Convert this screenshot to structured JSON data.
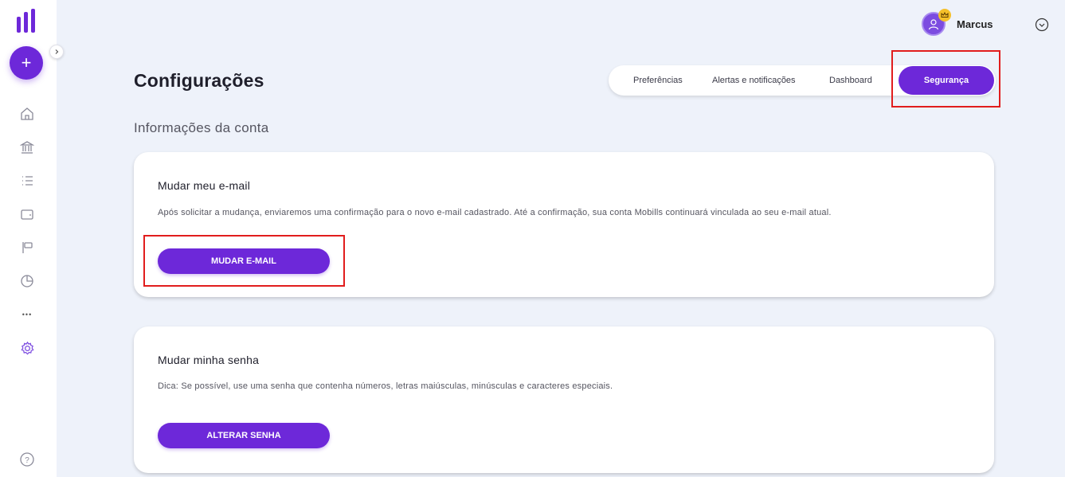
{
  "sidebar": {
    "add_label": "+",
    "icons": [
      "home-icon",
      "bank-icon",
      "list-icon",
      "wallet-icon",
      "flag-icon",
      "pie-chart-icon",
      "more-icon",
      "gear-icon",
      "help-icon"
    ],
    "more_label": "•••",
    "help_label": "?"
  },
  "user": {
    "name": "Marcus"
  },
  "page": {
    "title": "Configurações"
  },
  "tabs": [
    {
      "label": "Preferências"
    },
    {
      "label": "Alertas e notificações"
    },
    {
      "label": "Dashboard"
    },
    {
      "label": "Segurança",
      "active": true
    }
  ],
  "section": {
    "heading": "Informações da conta"
  },
  "cards": [
    {
      "title": "Mudar meu e-mail",
      "description": "Após solicitar a mudança, enviaremos uma confirmação para o novo e-mail cadastrado. Até a confirmação, sua conta Mobills continuará vinculada ao seu e-mail atual.",
      "button": "MUDAR E-MAIL"
    },
    {
      "title": "Mudar minha senha",
      "description": "Dica: Se possível, use uma senha que contenha números, letras maiúsculas, minúsculas e caracteres especiais.",
      "button": "ALTERAR SENHA"
    }
  ],
  "colors": {
    "accent": "#6d28d9",
    "background": "#eef2fa",
    "highlight": "#e11d1d"
  }
}
